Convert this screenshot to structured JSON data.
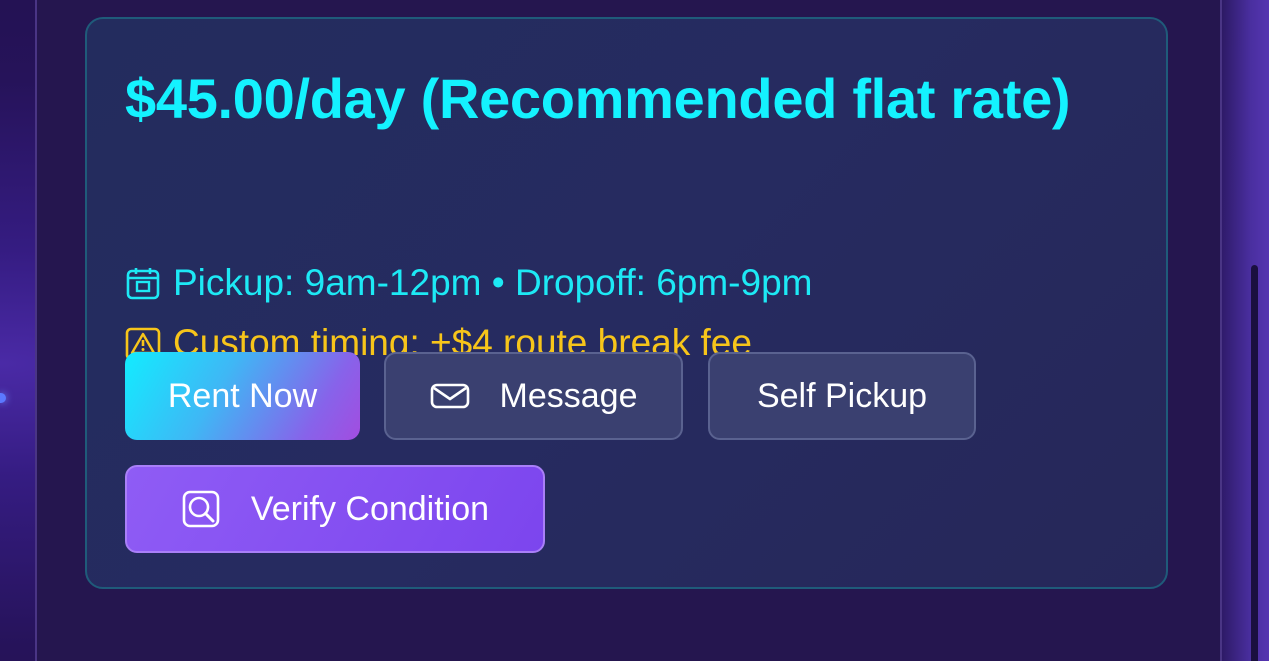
{
  "card": {
    "price_text": "$45.00/day (Recommended flat rate)",
    "time_text": "Pickup: 9am-12pm • Dropoff: 6pm-9pm",
    "warning_text": "Custom timing: +$4 route break fee"
  },
  "buttons": {
    "rent": "Rent Now",
    "message": "Message",
    "self_pickup": "Self Pickup",
    "verify": "Verify Condition"
  },
  "icons": {
    "time": "package-calendar-icon",
    "warning": "warning-triangle-icon",
    "message": "envelope-icon",
    "verify": "magnifier-icon"
  },
  "colors": {
    "accent_cyan": "#14f2ff",
    "warning_yellow": "#f7c51a",
    "verify_purple": "#7c45ee"
  }
}
